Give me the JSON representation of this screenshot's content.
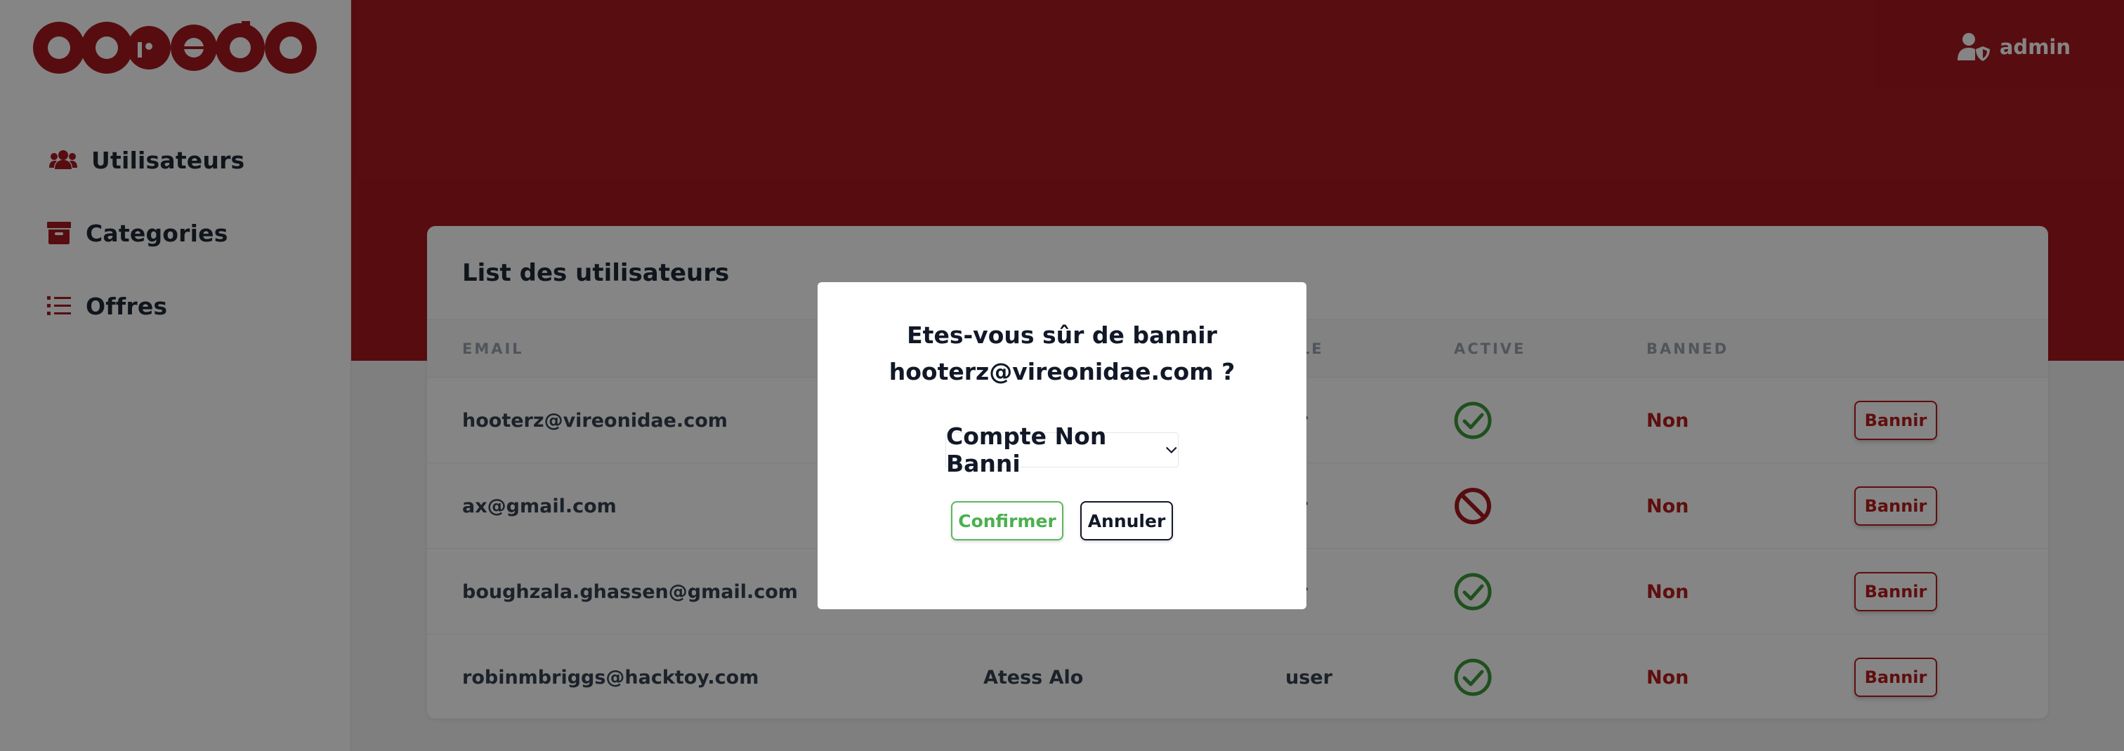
{
  "brand": {
    "logo_text": "ooredoo",
    "brand_color": "#a8191f",
    "logo_icon": "ooredoo-logo"
  },
  "sidebar": {
    "items": [
      {
        "label": "Utilisateurs",
        "icon": "users-icon"
      },
      {
        "label": "Categories",
        "icon": "archive-icon"
      },
      {
        "label": "Offres",
        "icon": "list-icon"
      }
    ]
  },
  "header": {
    "user_label": "admin",
    "user_icon": "user-shield-icon"
  },
  "table": {
    "title": "List des utilisateurs",
    "columns": [
      "EMAIL",
      "OLE",
      "ACTIVE",
      "BANNED"
    ],
    "rows": [
      {
        "email": "hooterz@vireonidae.com",
        "name": "",
        "role": "er",
        "active": true,
        "banned": "Non",
        "action": "Bannir"
      },
      {
        "email": "ax@gmail.com",
        "name": "",
        "role": "er",
        "active": false,
        "banned": "Non",
        "action": "Bannir"
      },
      {
        "email": "boughzala.ghassen@gmail.com",
        "name": "",
        "role": "er",
        "active": true,
        "banned": "Non",
        "action": "Bannir"
      },
      {
        "email": "robinmbriggs@hacktoy.com",
        "name": "Atess Alo",
        "role": "user",
        "active": true,
        "banned": "Non",
        "action": "Bannir"
      }
    ]
  },
  "modal": {
    "title_line1": "Etes-vous sûr de bannir",
    "title_line2": "hooterz@vireonidae.com ?",
    "select_value": "Compte Non Banni",
    "confirm_label": "Confirmer",
    "cancel_label": "Annuler"
  },
  "colors": {
    "active_green": "#3d9a3d",
    "inactive_red": "#a8191f",
    "banned_red": "#b91c1c",
    "confirm_green": "#4caf50"
  }
}
